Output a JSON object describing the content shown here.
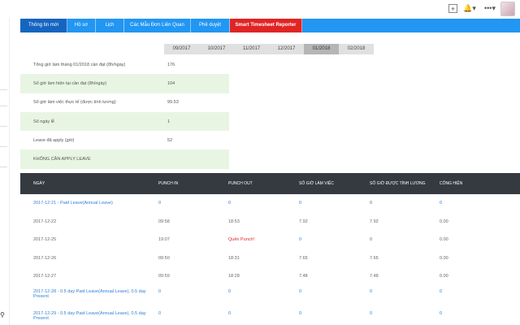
{
  "topbar": {
    "plus_icon": "plus-square-icon",
    "bell_icon": "bell-icon",
    "dots_icon": "more-dots-icon"
  },
  "left_strip": {
    "key_glyph": "⚲"
  },
  "tabs": [
    {
      "label": "Thông tin mới",
      "active": true
    },
    {
      "label": "Hồ sơ"
    },
    {
      "label": "Lịch"
    },
    {
      "label": "Các Mẫu Đơn Liên Quan"
    },
    {
      "label": "Phê duyệt"
    },
    {
      "label": "Smart Timesheet Reporter",
      "highlight": "#e02424"
    }
  ],
  "months": [
    "09/2017",
    "10/2017",
    "11/2017",
    "12/2017",
    "01/2018",
    "02/2018"
  ],
  "selected_month": "01/2018",
  "summary": [
    {
      "label": "Tổng giờ làm tháng 01/2018 cần đạt (8h/ngày)",
      "value": "176"
    },
    {
      "label": "Số giờ làm hiện tại cần đạt (8h/ngày)",
      "value": "104"
    },
    {
      "label": "Số giờ làm việc thực tế (được tính lương)",
      "value": "99.53"
    },
    {
      "label": "Số ngày lễ",
      "value": "1"
    },
    {
      "label": "Leave đã apply (giờ)",
      "value": "52"
    },
    {
      "label": "KHÔNG CẦN APPLY LEAVE",
      "value": ""
    }
  ],
  "detail": {
    "headers": [
      "NGÀY",
      "PUNCH IN",
      "PUNCH OUT",
      "SỐ GIỜ LÀM VIỆC",
      "SỐ GIỜ ĐƯỢC TÍNH LƯƠNG",
      "CÔNG HIỆN"
    ],
    "rows": [
      [
        "2017-12-21 - Paid Leave(Annual Leave)",
        "0",
        "0",
        "0",
        "0",
        "0"
      ],
      [
        "2017-12-22",
        "09:58",
        "18:53",
        "7.92",
        "7.92",
        "0.00"
      ],
      [
        "2017-12-25",
        "19:07",
        "Quên Punch!",
        "0",
        "0",
        "0.00"
      ],
      [
        "2017-12-26",
        "09:50",
        "18:31",
        "7.65",
        "7.65",
        "0.00"
      ],
      [
        "2017-12-27",
        "09:59",
        "18:28",
        "7.48",
        "7.48",
        "0.00"
      ],
      [
        "2017-12-28 - 0.5 day Paid Leave(Annual Leave), 0.5 day Present",
        "0",
        "0",
        "0",
        "0",
        "0"
      ],
      [
        "2017-12-29 - 0.5 day Paid Leave(Annual Leave), 0.5 day Present",
        "0",
        "0",
        "0",
        "0",
        "0"
      ]
    ]
  },
  "colors": {
    "tab_bar": "#2196f3",
    "active_tab": "#1565c0",
    "reporter_tab": "#e02424",
    "header_bg": "#343a40",
    "summary_alt": "#e8f5e3",
    "link": "#2f7fd6"
  }
}
